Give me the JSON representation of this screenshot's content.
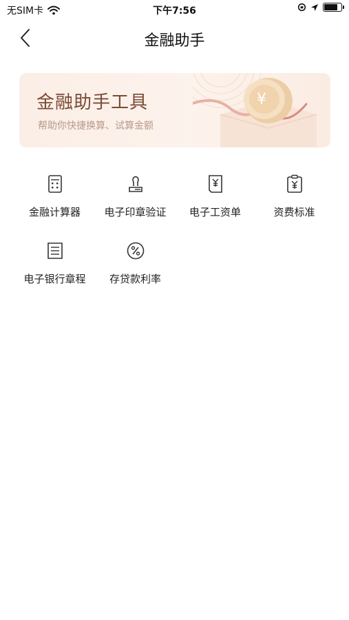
{
  "status_bar": {
    "carrier": "无SIM卡",
    "time": "下午7:56"
  },
  "nav": {
    "title": "金融助手"
  },
  "banner": {
    "title": "金融助手工具",
    "subtitle": "帮助你快捷换算、试算金额",
    "coin_symbol": "¥"
  },
  "tools": [
    {
      "label": "金融计算器",
      "icon": "calculator-icon"
    },
    {
      "label": "电子印章验证",
      "icon": "seal-icon"
    },
    {
      "label": "电子工资单",
      "icon": "payslip-icon"
    },
    {
      "label": "资费标准",
      "icon": "fee-clipboard-icon"
    },
    {
      "label": "电子银行章程",
      "icon": "document-icon"
    },
    {
      "label": "存贷款利率",
      "icon": "percent-icon"
    }
  ]
}
